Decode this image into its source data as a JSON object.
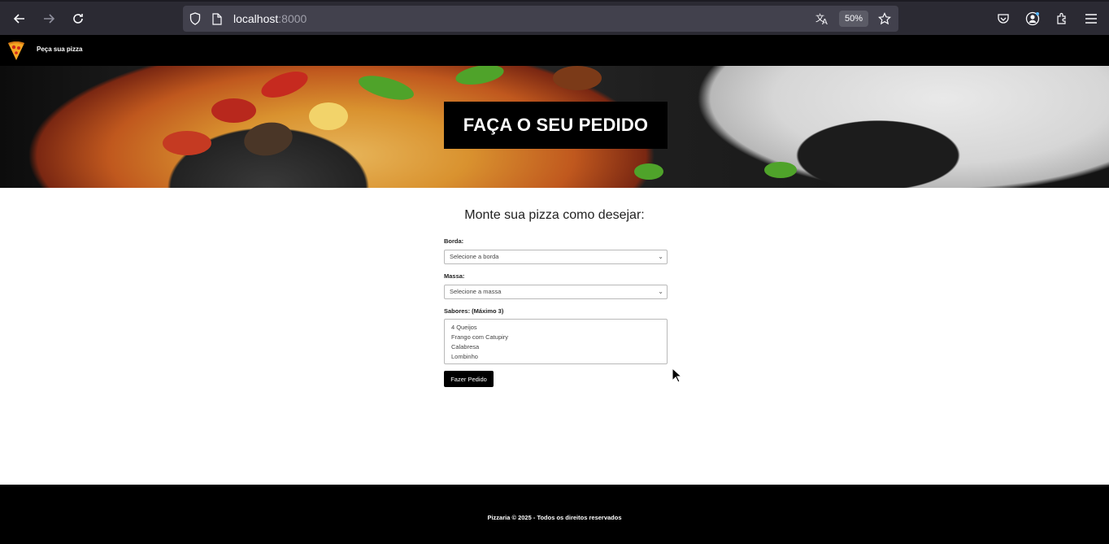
{
  "browser": {
    "url_host": "localhost",
    "url_port": ":8000",
    "zoom": "50%"
  },
  "header": {
    "brand": "Peça sua pizza"
  },
  "hero": {
    "title": "FAÇA O SEU PEDIDO"
  },
  "form": {
    "heading": "Monte sua pizza como desejar:",
    "borda_label": "Borda:",
    "borda_value": "Selecione a borda",
    "massa_label": "Massa:",
    "massa_value": "Selecione a massa",
    "sabores_label": "Sabores: (Máximo 3)",
    "sabores_options": [
      "4 Queijos",
      "Frango com Catupiry",
      "Calabresa",
      "Lombinho"
    ],
    "submit_label": "Fazer Pedido"
  },
  "footer": {
    "text": "Pizzaria © 2025 - Todos os direitos reservados"
  },
  "colors": {
    "header_bg": "#000000",
    "button_bg": "#000000",
    "browser_bg": "#2b2a33"
  }
}
